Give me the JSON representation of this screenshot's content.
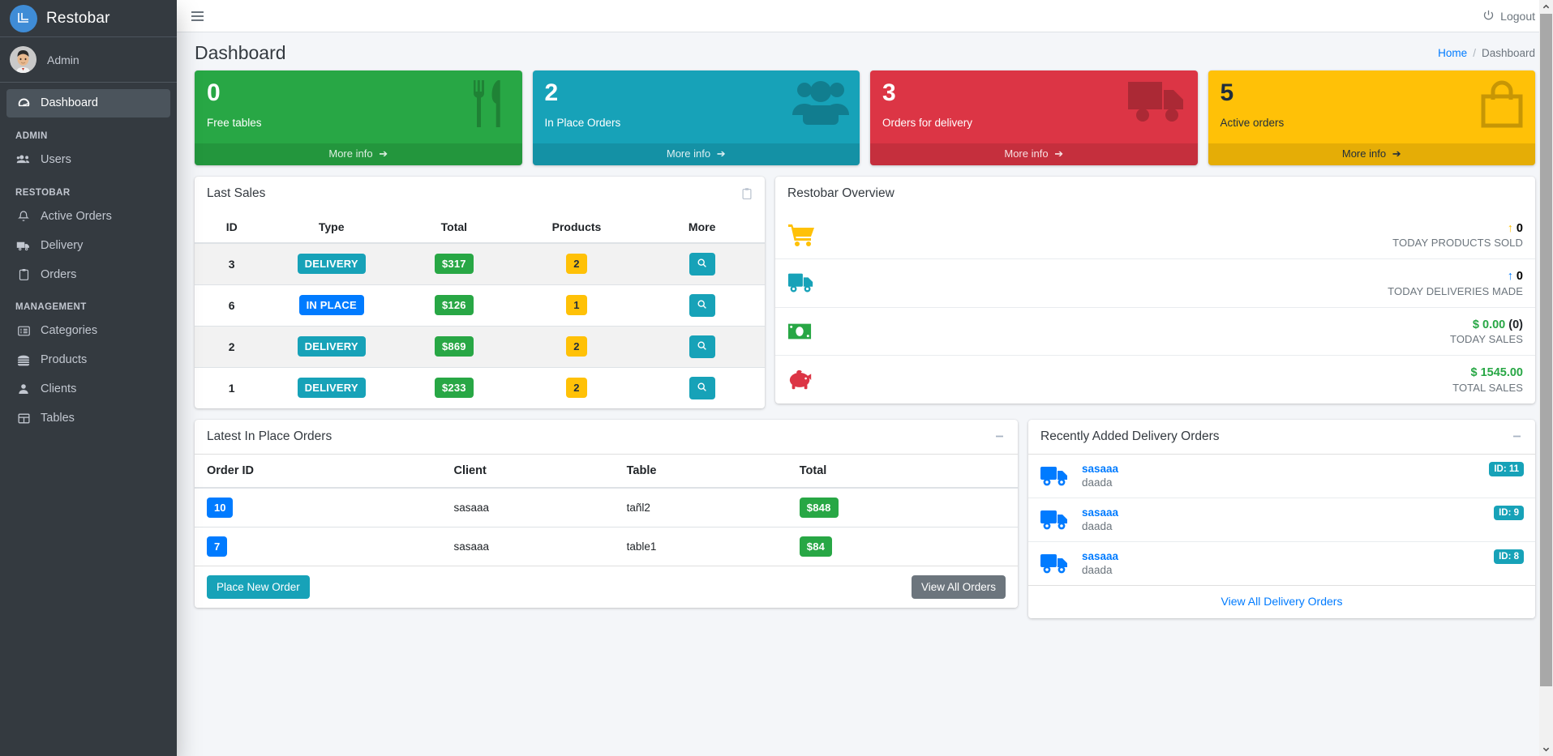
{
  "brand": {
    "title": "Restobar",
    "logo_icon": "restobar-logo-icon"
  },
  "user": {
    "name": "Admin",
    "avatar_icon": "user-avatar"
  },
  "sidebar": {
    "items": [
      {
        "label": "Dashboard",
        "icon": "tachometer-icon",
        "active": true
      }
    ],
    "groups": [
      {
        "header": "ADMIN",
        "items": [
          {
            "label": "Users",
            "icon": "users-icon"
          }
        ]
      },
      {
        "header": "RESTOBAR",
        "items": [
          {
            "label": "Active Orders",
            "icon": "bell-icon"
          },
          {
            "label": "Delivery",
            "icon": "truck-icon"
          },
          {
            "label": "Orders",
            "icon": "clipboard-icon"
          }
        ]
      },
      {
        "header": "MANAGEMENT",
        "items": [
          {
            "label": "Categories",
            "icon": "list-alt-icon"
          },
          {
            "label": "Products",
            "icon": "hamburger-icon"
          },
          {
            "label": "Clients",
            "icon": "user-icon"
          },
          {
            "label": "Tables",
            "icon": "table-icon"
          }
        ]
      }
    ]
  },
  "topbar": {
    "menu_icon": "hamburger-menu-icon",
    "logout_label": "Logout",
    "logout_icon": "power-off-icon"
  },
  "page": {
    "title": "Dashboard",
    "breadcrumb": {
      "home": "Home",
      "separator": "/",
      "current": "Dashboard"
    }
  },
  "info_boxes": [
    {
      "value": "0",
      "label": "Free tables",
      "footer": "More info",
      "color": "#28a745",
      "icon": "utensils-icon"
    },
    {
      "value": "2",
      "label": "In Place Orders",
      "footer": "More info",
      "color": "#17a2b8",
      "icon": "users-group-icon"
    },
    {
      "value": "3",
      "label": "Orders for delivery",
      "footer": "More info",
      "color": "#dc3545",
      "icon": "truck-icon"
    },
    {
      "value": "5",
      "label": "Active orders",
      "footer": "More info",
      "color": "#ffc107",
      "icon": "shopping-bag-icon"
    }
  ],
  "last_sales": {
    "title": "Last Sales",
    "tool_icon": "clipboard-icon",
    "columns": [
      "ID",
      "Type",
      "Total",
      "Products",
      "More"
    ],
    "rows": [
      {
        "id": "3",
        "type": "DELIVERY",
        "type_kind": "delivery",
        "total": "$317",
        "products": "2",
        "more_icon": "search-icon"
      },
      {
        "id": "6",
        "type": "IN PLACE",
        "type_kind": "inplace",
        "total": "$126",
        "products": "1",
        "more_icon": "search-icon"
      },
      {
        "id": "2",
        "type": "DELIVERY",
        "type_kind": "delivery",
        "total": "$869",
        "products": "2",
        "more_icon": "search-icon"
      },
      {
        "id": "1",
        "type": "DELIVERY",
        "type_kind": "delivery",
        "total": "$233",
        "products": "2",
        "more_icon": "search-icon"
      }
    ]
  },
  "overview": {
    "title": "Restobar Overview",
    "rows": [
      {
        "icon": "shopping-cart-icon",
        "icon_color": "#ffc107",
        "value": "0",
        "value_prefix": "↑",
        "value_color": "#ffc107",
        "label": "TODAY PRODUCTS SOLD"
      },
      {
        "icon": "truck-icon",
        "icon_color": "#17a2b8",
        "value": "0",
        "value_prefix": "↑",
        "value_color": "#007bff",
        "label": "TODAY DELIVERIES MADE"
      },
      {
        "icon": "money-bill-icon",
        "icon_color": "#28a745",
        "value": "$ 0.00",
        "value_suffix": "(0)",
        "value_color": "#28a745",
        "label": "TODAY SALES"
      },
      {
        "icon": "piggy-bank-icon",
        "icon_color": "#dc3545",
        "value": "$ 1545.00",
        "value_suffix": "",
        "value_color": "#28a745",
        "label": "TOTAL SALES"
      }
    ]
  },
  "inplace_orders": {
    "title": "Latest In Place Orders",
    "tool_icon": "minus-icon",
    "columns": [
      "Order ID",
      "Client",
      "Table",
      "Total"
    ],
    "rows": [
      {
        "order_id": "10",
        "client": "sasaaa",
        "table": "tañl2",
        "total": "$848"
      },
      {
        "order_id": "7",
        "client": "sasaaa",
        "table": "table1",
        "total": "$84"
      }
    ],
    "primary_button": "Place New Order",
    "secondary_button": "View All Orders"
  },
  "delivery_orders": {
    "title": "Recently Added Delivery Orders",
    "tool_icon": "minus-icon",
    "items": [
      {
        "name": "sasaaa",
        "desc": "daada",
        "badge": "ID: 11",
        "icon": "truck-icon"
      },
      {
        "name": "sasaaa",
        "desc": "daada",
        "badge": "ID: 9",
        "icon": "truck-icon"
      },
      {
        "name": "sasaaa",
        "desc": "daada",
        "badge": "ID: 8",
        "icon": "truck-icon"
      }
    ],
    "footer_link": "View All Delivery Orders"
  },
  "scrollbar": {
    "up_icon": "chevron-up-icon",
    "down_icon": "chevron-down-icon"
  }
}
